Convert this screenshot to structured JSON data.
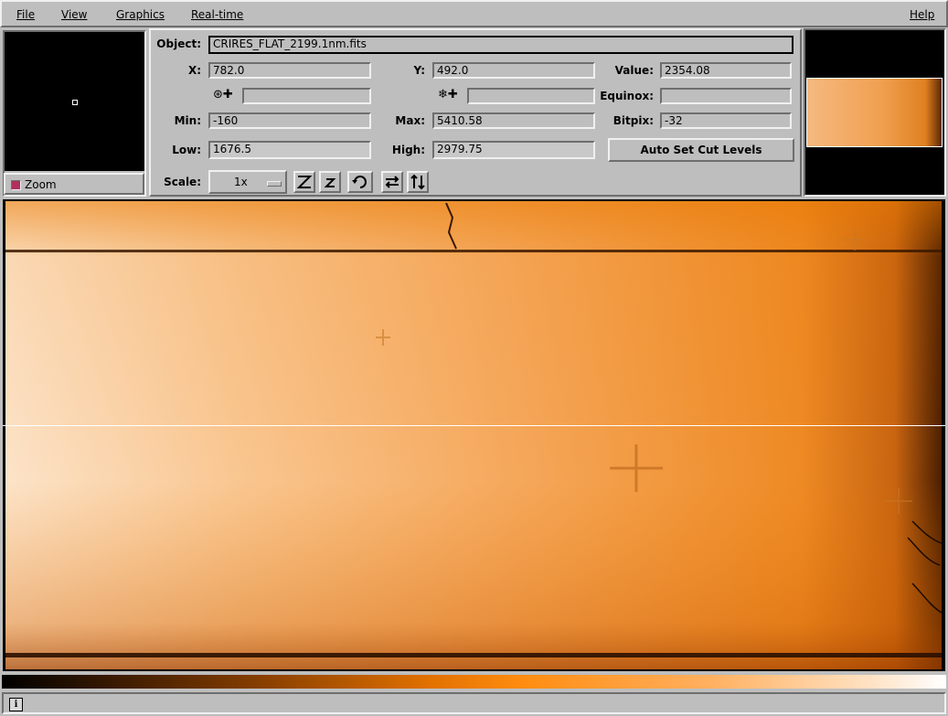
{
  "menubar": {
    "items": [
      {
        "label": "File"
      },
      {
        "label": "View"
      },
      {
        "label": "Graphics"
      },
      {
        "label": "Real-time"
      }
    ],
    "help": "Help"
  },
  "zoom": {
    "toggle_label": "Zoom",
    "toggle_checked": true
  },
  "info": {
    "object_label": "Object:",
    "object_value": "CRIRES_FLAT_2199.1nm.fits",
    "x_label": "X:",
    "x_value": "782.0",
    "y_label": "Y:",
    "y_value": "492.0",
    "value_label": "Value:",
    "value_value": "2354.08",
    "wcs1_value": "",
    "wcs2_value": "",
    "equinox_label": "Equinox:",
    "equinox_value": "",
    "min_label": "Min:",
    "min_value": "-160",
    "max_label": "Max:",
    "max_value": "5410.58",
    "bitpix_label": "Bitpix:",
    "bitpix_value": "-32",
    "low_label": "Low:",
    "low_value": "1676.5",
    "high_label": "High:",
    "high_value": "2979.75",
    "auto_cut_label": "Auto Set Cut Levels",
    "scale_label": "Scale:",
    "scale_value": "1x"
  },
  "toolbar_icons": [
    "zoom-in-icon",
    "zoom-out-icon",
    "rotate-icon",
    "flip-x-icon",
    "flip-y-icon"
  ],
  "colors": {
    "background": "#bebebe",
    "image_orange": "#f09030",
    "zoom_check": "#b03060"
  },
  "status": {
    "icon": "i"
  }
}
